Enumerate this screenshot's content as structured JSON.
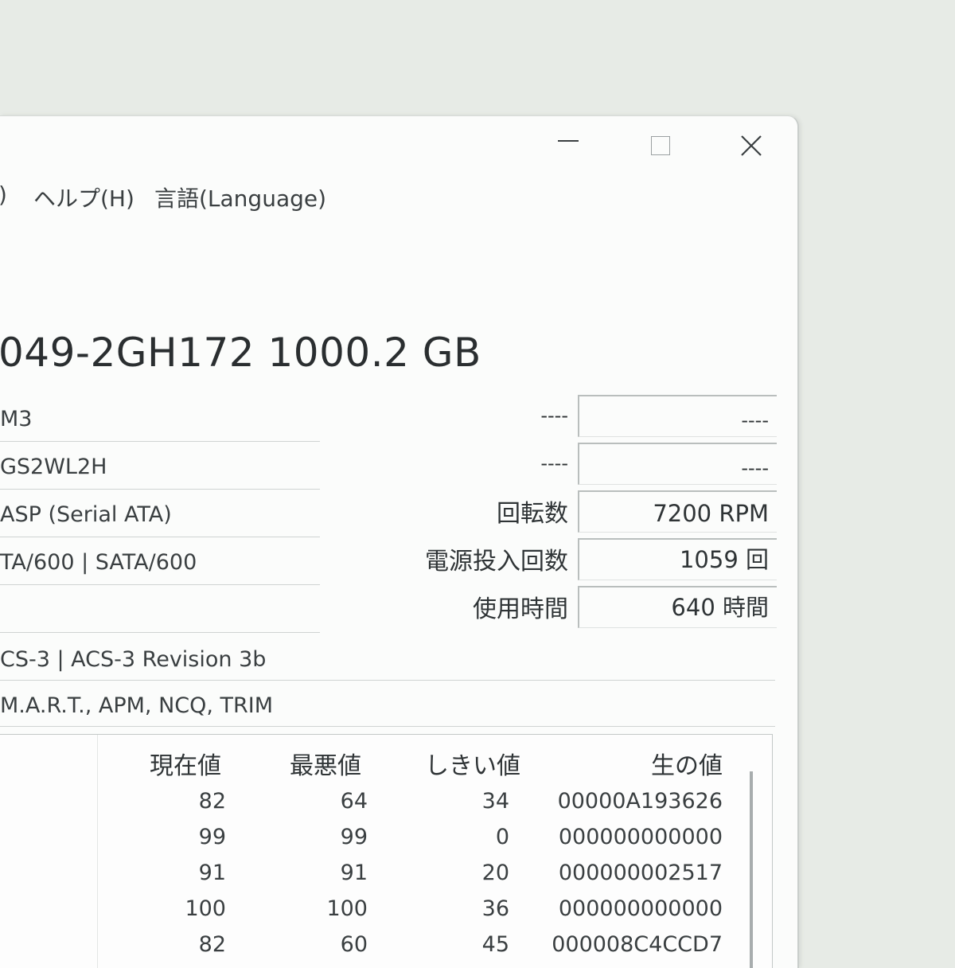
{
  "window": {
    "minimize_glyph": "—",
    "close_glyph": "✕"
  },
  "menu": {
    "items": [
      {
        "label": ")"
      },
      {
        "label": "ヘルプ(H)"
      },
      {
        "label": "言語(Language)"
      }
    ]
  },
  "drive": {
    "model_title": "049-2GH172 1000.2 GB",
    "left_fields": [
      {
        "value": "M3"
      },
      {
        "value": "GS2WL2H"
      },
      {
        "value": "ASP (Serial ATA)"
      },
      {
        "value": "TA/600 | SATA/600"
      },
      {
        "value": ""
      }
    ],
    "right_fields": [
      {
        "label": "----",
        "value": "----"
      },
      {
        "label": "----",
        "value": "----"
      },
      {
        "label": "回転数",
        "value": "7200 RPM"
      },
      {
        "label": "電源投入回数",
        "value": "1059 回"
      },
      {
        "label": "使用時間",
        "value": "640 時間"
      }
    ],
    "standard": "CS-3 | ACS-3 Revision 3b",
    "features": "M.A.R.T., APM, NCQ, TRIM"
  },
  "smart": {
    "headers": {
      "current": "現在値",
      "worst": "最悪値",
      "threshold": "しきい値",
      "raw": "生の値"
    },
    "rows": [
      {
        "current": "82",
        "worst": "64",
        "threshold": "34",
        "raw": "00000A193626"
      },
      {
        "current": "99",
        "worst": "99",
        "threshold": "0",
        "raw": "000000000000"
      },
      {
        "current": "91",
        "worst": "91",
        "threshold": "20",
        "raw": "000000002517"
      },
      {
        "current": "100",
        "worst": "100",
        "threshold": "36",
        "raw": "000000000000"
      },
      {
        "current": "82",
        "worst": "60",
        "threshold": "45",
        "raw": "000008C4CCD7"
      }
    ]
  }
}
